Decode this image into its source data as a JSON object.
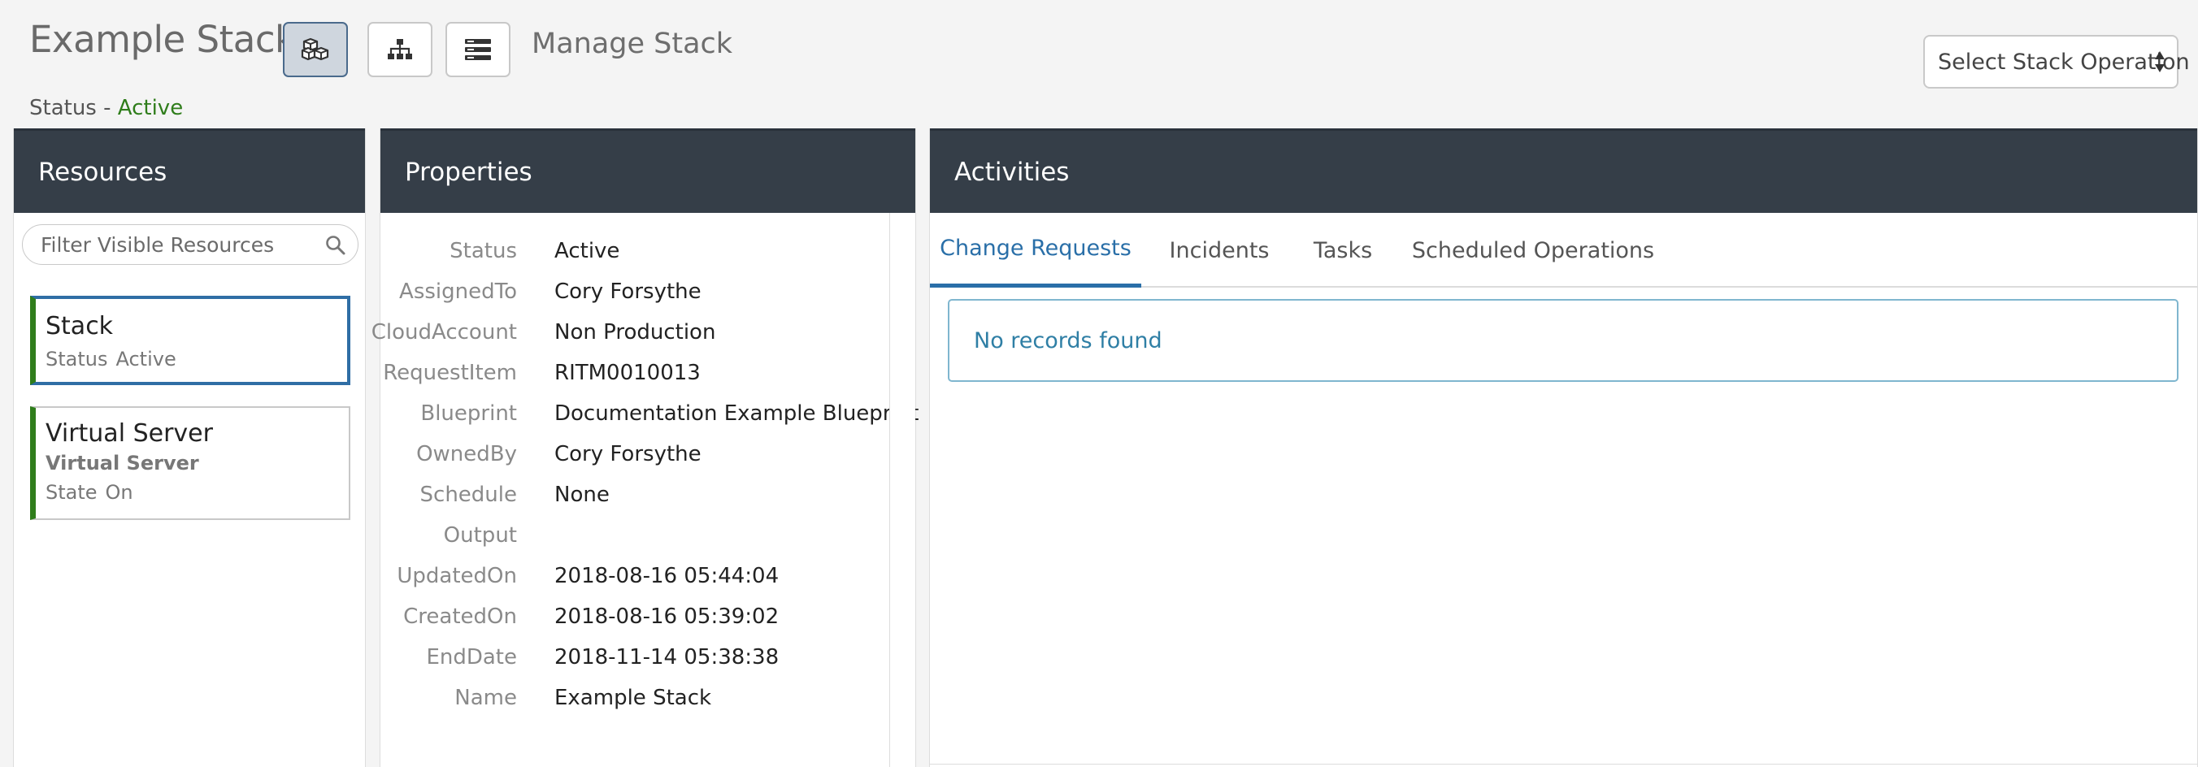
{
  "header": {
    "title": "Example Stack",
    "views": [
      {
        "name": "resources-view",
        "icon": "boxes-icon",
        "active": true
      },
      {
        "name": "hierarchy-view",
        "icon": "hierarchy-icon",
        "active": false
      },
      {
        "name": "list-view",
        "icon": "list-icon",
        "active": false
      }
    ],
    "manage_label": "Manage Stack",
    "status_prefix": "Status - ",
    "status_value": "Active",
    "operation_select": "Select Stack Operation"
  },
  "colors": {
    "panel_header": "#353e48",
    "active_green": "#2f7d1b",
    "accent_blue": "#2a6fa8",
    "selected_border": "#2f6ea5"
  },
  "resources": {
    "title": "Resources",
    "filter_placeholder": "Filter Visible Resources",
    "items": [
      {
        "name": "Stack",
        "meta_key": "Status",
        "meta_value": "Active",
        "selected": true
      },
      {
        "name": "Virtual Server",
        "subtitle": "Virtual Server",
        "meta_key": "State",
        "meta_value": "On",
        "selected": false
      }
    ]
  },
  "properties": {
    "title": "Properties",
    "rows": [
      {
        "key": "Status",
        "value": "Active"
      },
      {
        "key": "AssignedTo",
        "value": "Cory Forsythe"
      },
      {
        "key": "CloudAccount",
        "value": "Non Production"
      },
      {
        "key": "RequestItem",
        "value": "RITM0010013"
      },
      {
        "key": "Blueprint",
        "value": "Documentation Example Blueprint"
      },
      {
        "key": "OwnedBy",
        "value": "Cory Forsythe"
      },
      {
        "key": "Schedule",
        "value": "None"
      },
      {
        "key": "Output",
        "value": ""
      },
      {
        "key": "UpdatedOn",
        "value": "2018-08-16 05:44:04"
      },
      {
        "key": "CreatedOn",
        "value": "2018-08-16 05:39:02"
      },
      {
        "key": "EndDate",
        "value": "2018-11-14 05:38:38"
      },
      {
        "key": "Name",
        "value": "Example Stack"
      }
    ]
  },
  "activities": {
    "title": "Activities",
    "tabs": [
      {
        "label": "Change Requests",
        "active": true
      },
      {
        "label": "Incidents",
        "active": false
      },
      {
        "label": "Tasks",
        "active": false
      },
      {
        "label": "Scheduled Operations",
        "active": false
      }
    ],
    "empty_message": "No records found"
  }
}
